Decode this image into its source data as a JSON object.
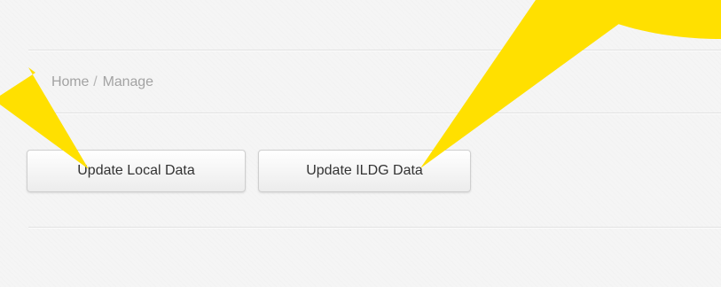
{
  "breadcrumb": {
    "home": "Home",
    "separator": "/",
    "current": "Manage"
  },
  "actions": {
    "update_local_label": "Update Local Data",
    "update_ildg_label": "Update ILDG Data"
  },
  "colors": {
    "callout": "#ffe000",
    "background": "#f5f5f5",
    "breadcrumb_text": "#a3a3a3",
    "button_text": "#333333"
  }
}
